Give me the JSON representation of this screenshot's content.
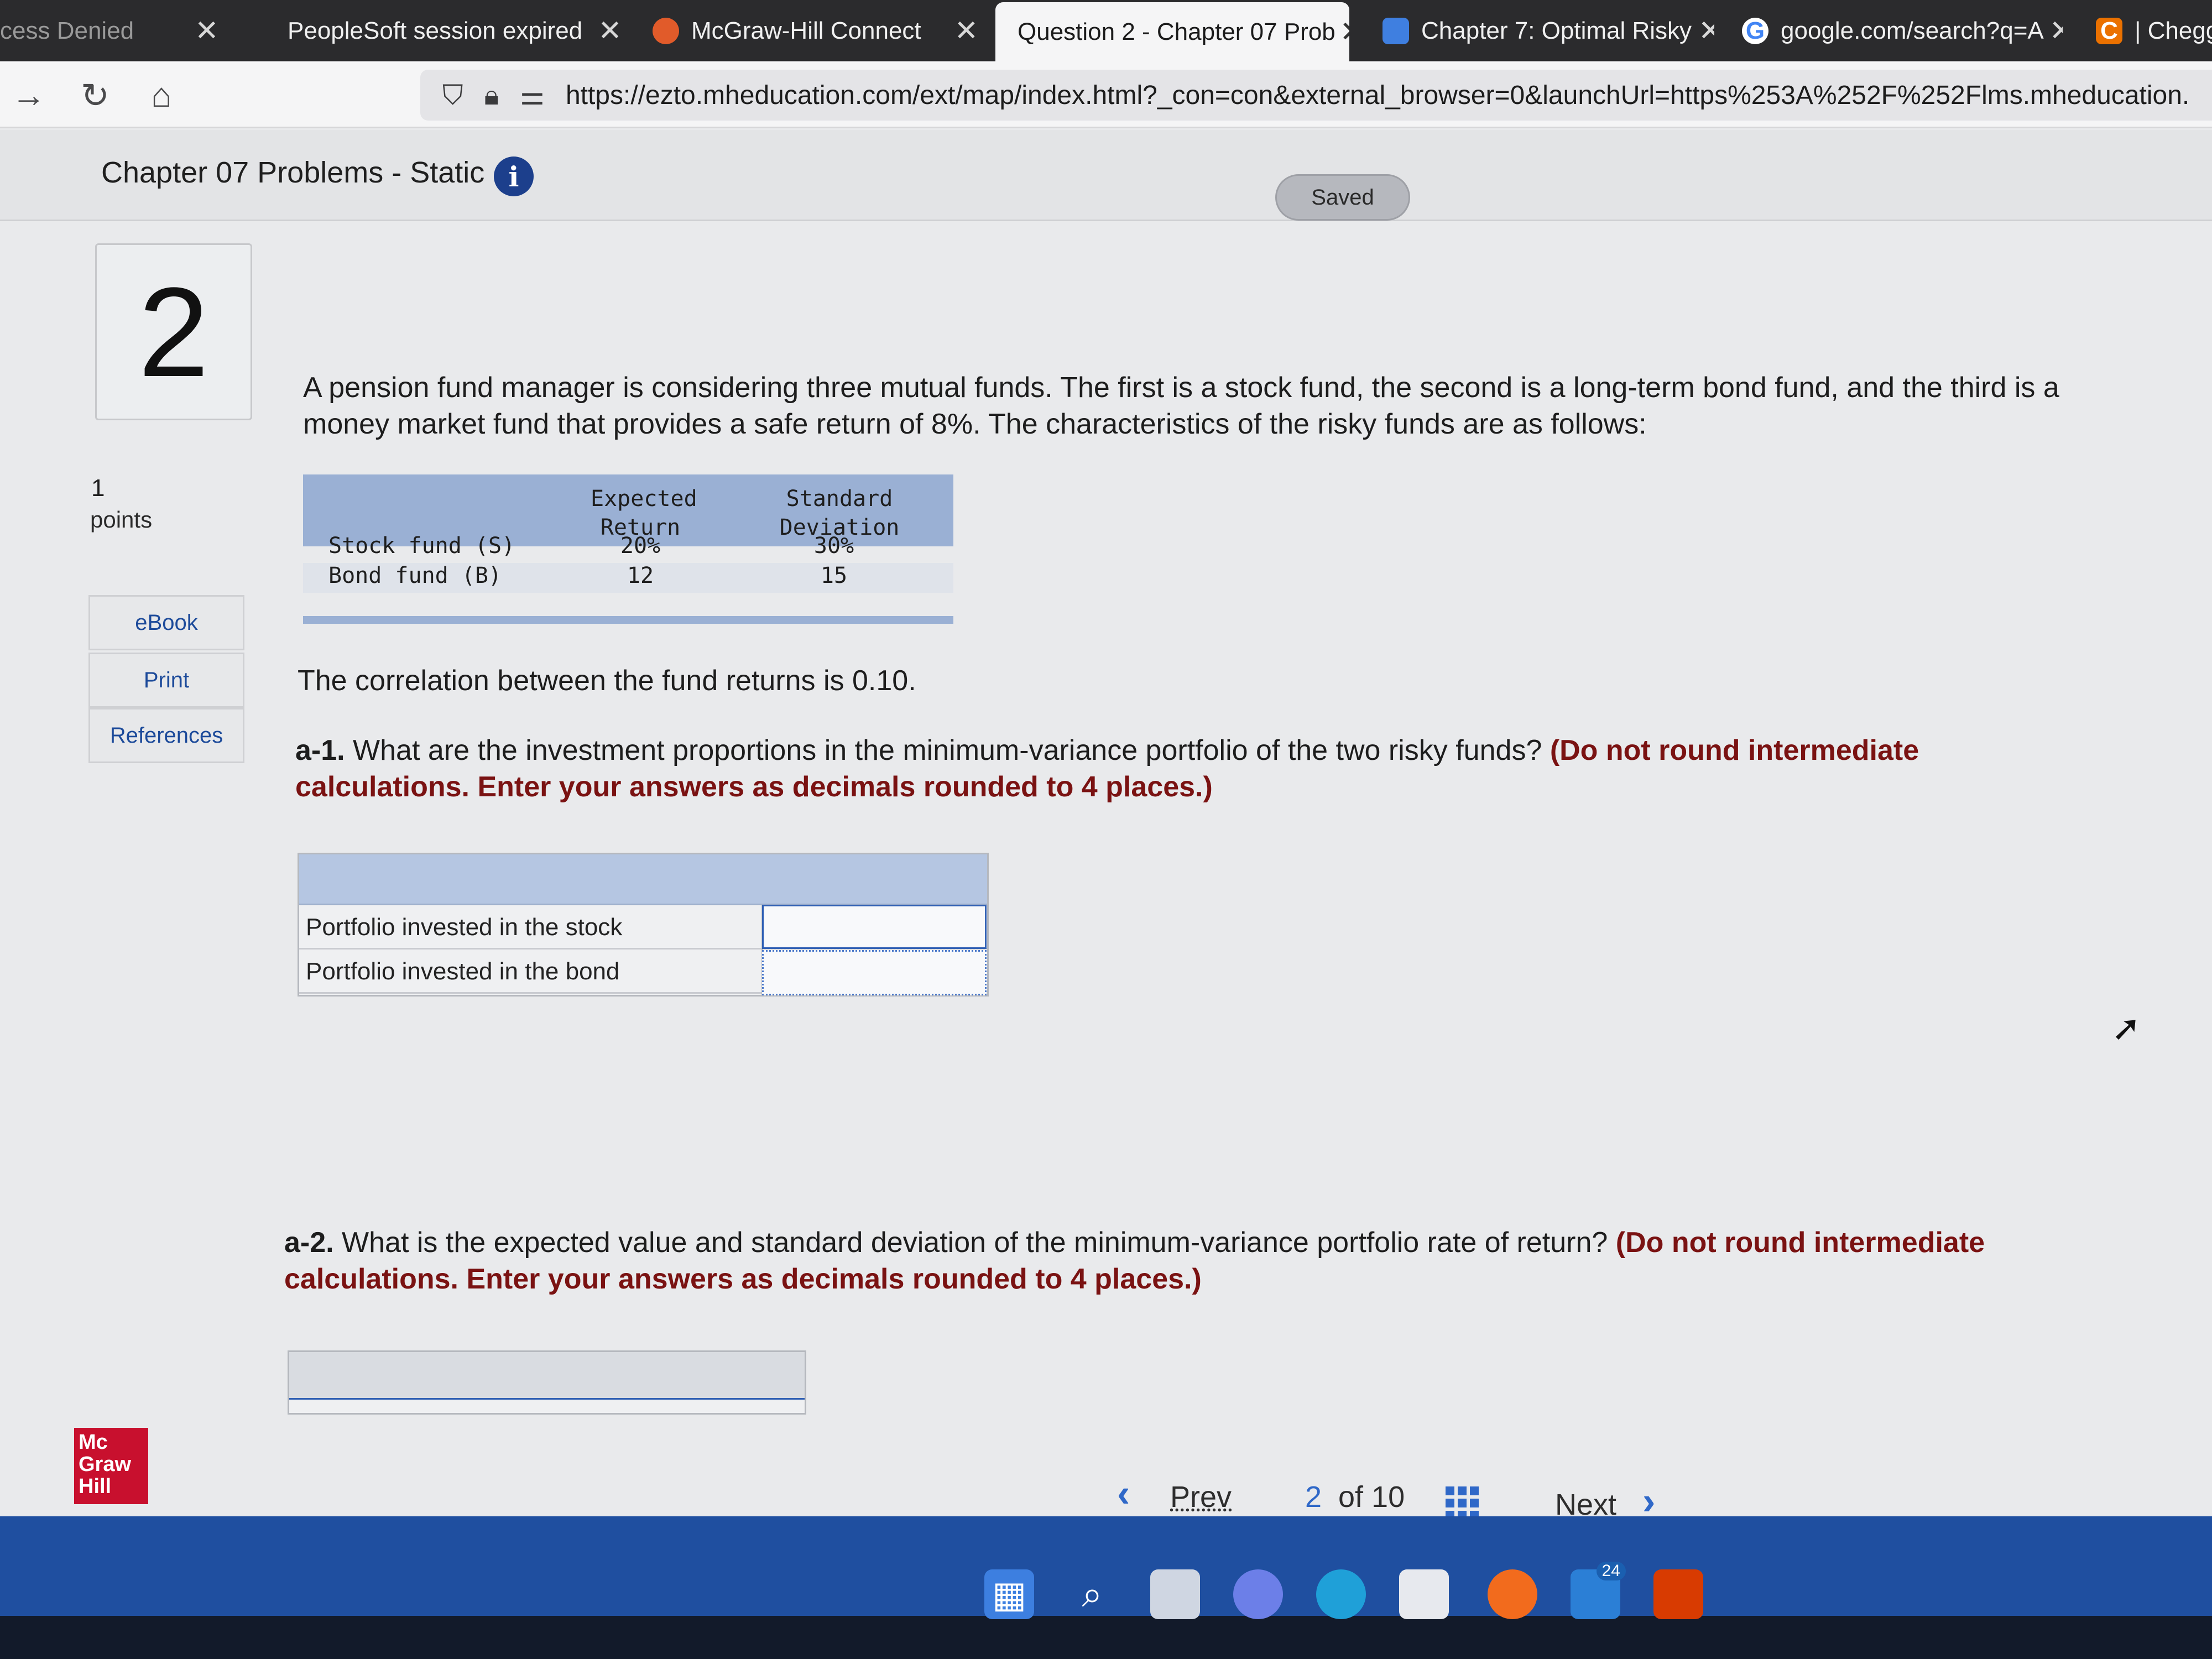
{
  "browser": {
    "tabs": [
      {
        "label": "cess Denied",
        "active": false
      },
      {
        "label": "PeopleSoft session expired",
        "active": false
      },
      {
        "label": "McGraw-Hill Connect",
        "active": false
      },
      {
        "label": "Question 2 - Chapter 07 Prob",
        "active": true
      },
      {
        "label": "Chapter 7: Optimal Risky",
        "active": false
      },
      {
        "label": "google.com/search?q=A",
        "active": false
      },
      {
        "label": "| Chegg",
        "active": false
      }
    ],
    "close_glyph": "✕",
    "url": "https://ezto.mheducation.com/ext/map/index.html?_con=con&external_browser=0&launchUrl=https%253A%252F%252Flms.mheducation."
  },
  "header": {
    "title": "Chapter 07 Problems - Static",
    "info_glyph": "i",
    "saved_label": "Saved"
  },
  "question": {
    "number": "2",
    "points_value": "1",
    "points_label": "points",
    "rail_buttons": [
      "eBook",
      "Print",
      "References"
    ],
    "intro": "A pension fund manager is considering three mutual funds. The first is a stock fund, the second is a long-term bond fund, and the third is a money market fund that provides a safe return of 8%. The characteristics of the risky funds are as follows:",
    "table": {
      "headers": [
        [
          "Expected",
          "Return"
        ],
        [
          "Standard",
          "Deviation"
        ]
      ],
      "rows": [
        {
          "label": "Stock fund (S)",
          "values": [
            "20%",
            "30%"
          ]
        },
        {
          "label": "Bond fund (B)",
          "values": [
            "12",
            "15"
          ]
        }
      ]
    },
    "correlation": "The correlation between the fund returns is 0.10.",
    "a1": {
      "tag": "a-1.",
      "text": " What are the investment proportions in the minimum-variance portfolio of the two risky funds? ",
      "instruction": "(Do not round intermediate calculations. Enter your answers as decimals rounded to 4 places.)",
      "rows": [
        {
          "label": "Portfolio invested in the stock",
          "value": ""
        },
        {
          "label": "Portfolio invested in the bond",
          "value": ""
        }
      ]
    },
    "a2": {
      "tag": "a-2.",
      "text": " What is the expected value and standard deviation of the minimum-variance portfolio rate of return? ",
      "instruction": "(Do not round intermediate calculations. Enter your answers as decimals rounded to 4 places.)"
    }
  },
  "nav": {
    "prev_label": "Prev",
    "position": "2",
    "of_label": "of 10",
    "next_label": "Next"
  },
  "logo": {
    "lines": [
      "Mc",
      "Graw",
      "Hill"
    ]
  },
  "taskbar": {
    "mail_badge": "24"
  },
  "colors": {
    "accent_blue": "#2f68c8",
    "instruction_red": "#7a1212",
    "table_header": "#9ab0d4",
    "logo_red": "#c8102e",
    "taskbar_blue": "#1f4fa0"
  }
}
